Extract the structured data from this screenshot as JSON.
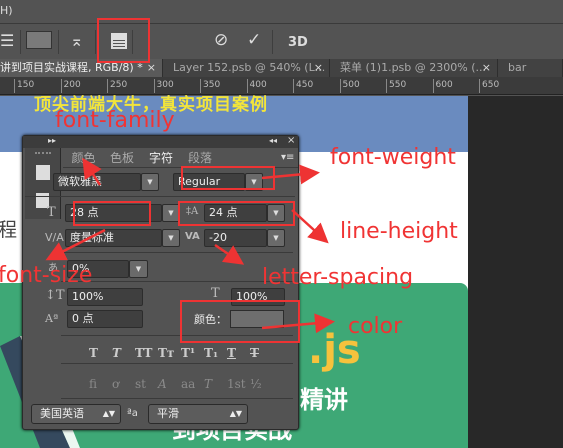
{
  "menubar": {
    "fragment": "H)"
  },
  "toolbar": {
    "icons": [
      "align-justify-icon",
      "color-swatch",
      "warp-text-icon",
      "character-panel-icon",
      "cancel-icon",
      "commit-icon",
      "3d-icon"
    ],
    "cancel": "⊘",
    "commit": "✓",
    "three_d": "3D"
  },
  "tabs": [
    {
      "label": "讲到项目实战课程, RGB/8) *",
      "close": "×"
    },
    {
      "label": "Layer 152.psb @ 540% (L...",
      "close": "×"
    },
    {
      "label": "菜单 (1)1.psb @ 2300% (...",
      "close": "×"
    },
    {
      "label": "bar",
      "close": ""
    }
  ],
  "ruler": [
    "150",
    "200",
    "250",
    "300",
    "350",
    "400",
    "450",
    "500",
    "550",
    "600",
    "650"
  ],
  "canvas": {
    "headline": "顶尖前端大牛，真实项目案例",
    "side_text": "程",
    "js": ".js",
    "line1": "精讲",
    "line2": "到项目实战"
  },
  "panel": {
    "tabs": [
      "颜色",
      "色板",
      "字符",
      "段落"
    ],
    "font_family": "微软雅黑",
    "font_style": "Regular",
    "font_size": "28 点",
    "leading": "24 点",
    "kerning": "度量标准",
    "tracking": "-20",
    "tsume": "0%",
    "vertical_scale": "100%",
    "horizontal_scale": "100%",
    "baseline_shift": "0 点",
    "color_label": "颜色：",
    "color_value": "#6e6e6e",
    "styles": [
      "T",
      "T",
      "TT",
      "Tт",
      "T¹",
      "T₁",
      "T",
      "T"
    ],
    "opentype": [
      "ﬁ",
      "ơ",
      "st",
      "A",
      "aa",
      "T",
      "1st",
      "½"
    ],
    "language": "美国英语",
    "aa_icon": "ªa",
    "antialias": "平滑"
  },
  "annotations": {
    "font_family": "font-family",
    "font_weight": "font-weight",
    "line_height": "line-height",
    "font_size": "font-size",
    "letter_spacing": "letter-spacing",
    "color": "color"
  }
}
